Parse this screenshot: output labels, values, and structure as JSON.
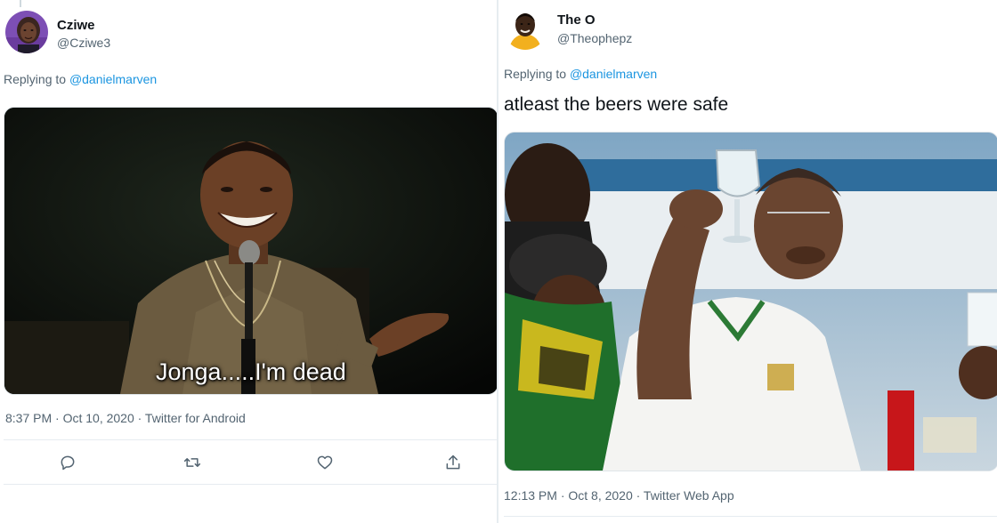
{
  "left_tweet": {
    "display_name": "Cziwe",
    "handle": "@Cziwe3",
    "replying_prefix": "Replying to ",
    "replying_to": "@danielmarven",
    "media_caption": "Jonga.....I'm  dead",
    "timestamp": "8:37 PM · Oct 10, 2020 · Twitter for Android",
    "actions": [
      "reply-icon",
      "retweet-icon",
      "like-icon",
      "share-icon"
    ]
  },
  "right_tweet": {
    "display_name": "The O",
    "handle": "@Theophepz",
    "replying_prefix": "Replying to ",
    "replying_to": "@danielmarven",
    "text": "atleast the beers were safe",
    "timestamp": "12:13 PM · Oct 8, 2020 · Twitter Web App"
  },
  "colors": {
    "link": "#1b95e0",
    "secondary_text": "#536471",
    "divider": "#e6ecf0"
  }
}
